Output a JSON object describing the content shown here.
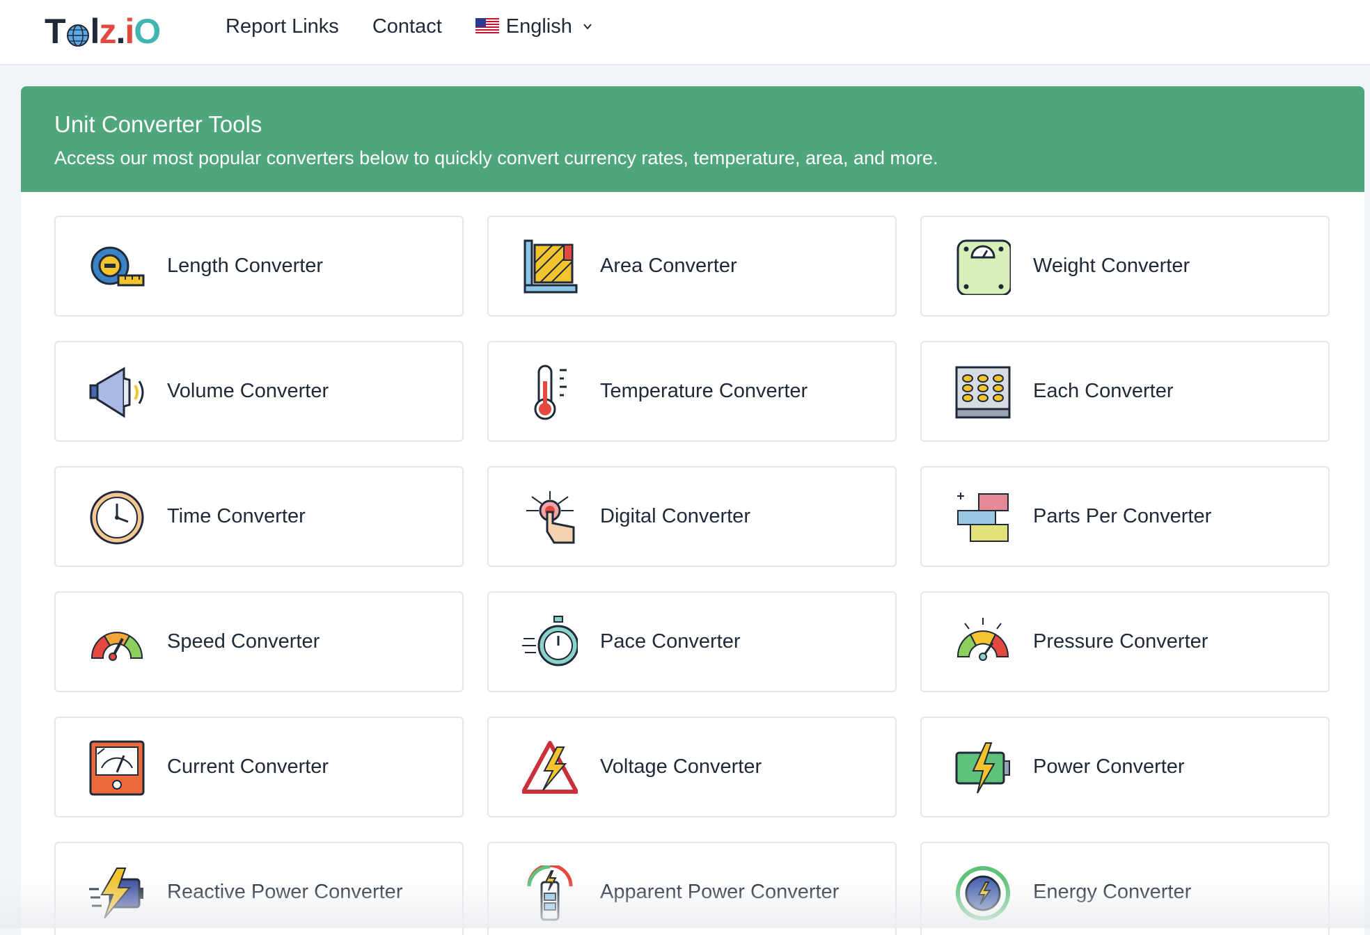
{
  "header": {
    "logo_chars": [
      "T",
      "o",
      "l",
      "z",
      ".",
      "i",
      "O"
    ],
    "nav_links": [
      "Report Links",
      "Contact"
    ],
    "language": "English"
  },
  "panel": {
    "title": "Unit Converter Tools",
    "description": "Access our most popular converters below to quickly convert currency rates, temperature, area, and more."
  },
  "converters": [
    {
      "label": "Length Converter",
      "icon": "tape-measure-icon"
    },
    {
      "label": "Area Converter",
      "icon": "area-ruler-icon"
    },
    {
      "label": "Weight Converter",
      "icon": "weighing-scale-icon"
    },
    {
      "label": "Volume Converter",
      "icon": "megaphone-icon"
    },
    {
      "label": "Temperature Converter",
      "icon": "thermometer-icon"
    },
    {
      "label": "Each Converter",
      "icon": "egg-tray-icon"
    },
    {
      "label": "Time Converter",
      "icon": "clock-icon"
    },
    {
      "label": "Digital Converter",
      "icon": "touch-tech-icon"
    },
    {
      "label": "Parts Per Converter",
      "icon": "blocks-icon"
    },
    {
      "label": "Speed Converter",
      "icon": "speedometer-icon"
    },
    {
      "label": "Pace Converter",
      "icon": "stopwatch-icon"
    },
    {
      "label": "Pressure Converter",
      "icon": "pressure-gauge-icon"
    },
    {
      "label": "Current Converter",
      "icon": "ammeter-icon"
    },
    {
      "label": "Voltage Converter",
      "icon": "high-voltage-sign-icon"
    },
    {
      "label": "Power Converter",
      "icon": "battery-charge-icon"
    },
    {
      "label": "Reactive Power Converter",
      "icon": "fast-battery-icon"
    },
    {
      "label": "Apparent Power Converter",
      "icon": "battery-gauge-icon"
    },
    {
      "label": "Energy Converter",
      "icon": "energy-cycle-icon"
    }
  ],
  "colors": {
    "header_green": "#4fa57c",
    "page_bg": "#f1f4f8",
    "logo_dark": "#1f2937",
    "logo_red": "#e3493f",
    "logo_teal": "#3fb6b0"
  }
}
